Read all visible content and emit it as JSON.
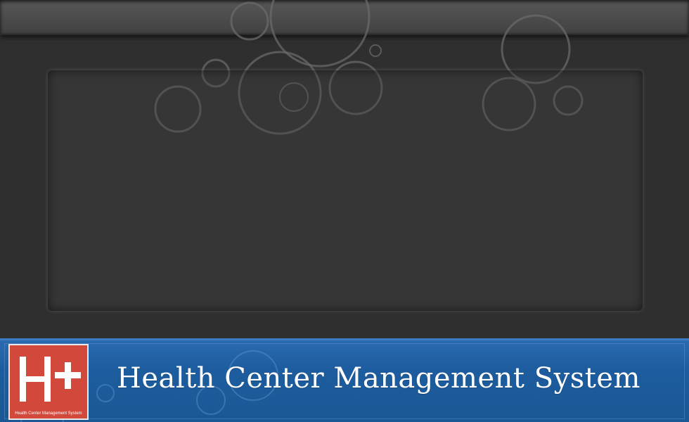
{
  "app": {
    "title": "Health Center Management System",
    "logo_text": "H+",
    "logo_caption": "Health Center Management System"
  },
  "colors": {
    "background": "#2f2f2f",
    "top_bar": "#4a4a4a",
    "banner_blue": "#1d5d9f",
    "logo_red": "#d2483b"
  }
}
